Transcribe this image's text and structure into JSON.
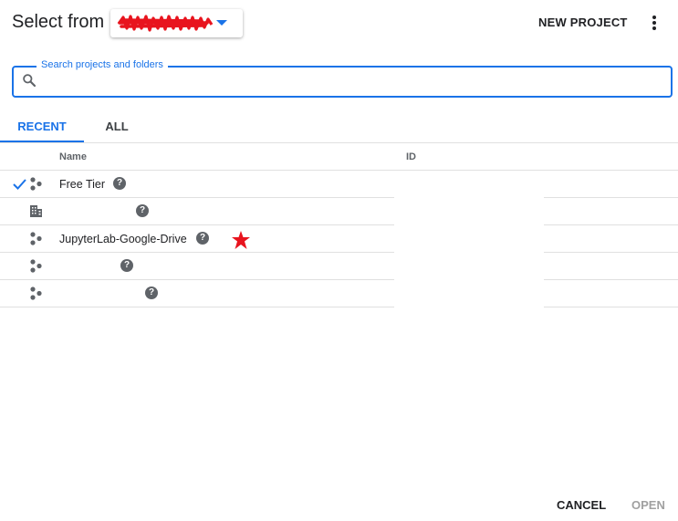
{
  "header": {
    "title": "Select from",
    "new_project_label": "NEW PROJECT"
  },
  "search": {
    "label": "Search projects and folders",
    "value": ""
  },
  "tabs": [
    {
      "label": "RECENT",
      "active": true
    },
    {
      "label": "ALL",
      "active": false
    }
  ],
  "table": {
    "columns": [
      "Name",
      "ID"
    ],
    "rows": [
      {
        "selected": true,
        "icon": "project-icon",
        "name": "Free Tier",
        "id": ""
      },
      {
        "selected": false,
        "icon": "organization-icon",
        "name": "",
        "id": ""
      },
      {
        "selected": false,
        "icon": "project-icon",
        "name": "JupyterLab-Google-Drive",
        "id": ""
      },
      {
        "selected": false,
        "icon": "project-icon",
        "name": "",
        "id": ""
      },
      {
        "selected": false,
        "icon": "project-icon",
        "name": "",
        "id": ""
      }
    ]
  },
  "footer": {
    "cancel_label": "CANCEL",
    "open_label": "OPEN"
  },
  "colors": {
    "accent": "#1a73e8",
    "redaction": "#e8141e",
    "text": "#202124",
    "disabled": "#a0a0a0"
  }
}
